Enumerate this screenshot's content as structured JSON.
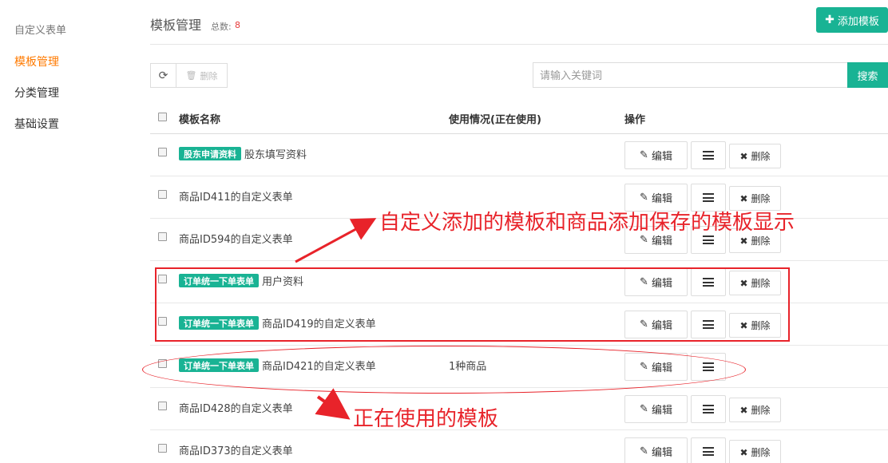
{
  "sidebar": {
    "items": [
      {
        "label": "自定义表单"
      },
      {
        "label": "模板管理"
      },
      {
        "label": "分类管理"
      },
      {
        "label": "基础设置"
      }
    ]
  },
  "header": {
    "title": "模板管理",
    "total_label": "总数:",
    "total_count": "8",
    "add_button": "添加模板"
  },
  "toolbar": {
    "delete_label": "删除",
    "search_placeholder": "请输入关键词",
    "search_button": "搜索"
  },
  "table": {
    "columns": [
      "模板名称",
      "使用情况(正在使用)",
      "操作"
    ],
    "edit_label": "编辑",
    "delete_label": "删除",
    "rows": [
      {
        "tag": "股东申请资料",
        "name": "股东填写资料",
        "usage": ""
      },
      {
        "tag": "",
        "name": "商品ID411的自定义表单",
        "usage": ""
      },
      {
        "tag": "",
        "name": "商品ID594的自定义表单",
        "usage": ""
      },
      {
        "tag": "订单统一下单表单",
        "name": "用户资料",
        "usage": ""
      },
      {
        "tag": "订单统一下单表单",
        "name": "商品ID419的自定义表单",
        "usage": ""
      },
      {
        "tag": "订单统一下单表单",
        "name": "商品ID421的自定义表单",
        "usage": "1种商品"
      },
      {
        "tag": "",
        "name": "商品ID428的自定义表单",
        "usage": ""
      },
      {
        "tag": "",
        "name": "商品ID373的自定义表单",
        "usage": ""
      }
    ]
  },
  "annotations": {
    "top_note": "自定义添加的模板和商品添加保存的模板显示",
    "bottom_note": "正在使用的模板",
    "color": "#e8232a"
  },
  "colors": {
    "accent": "#19b394",
    "active_nav": "#ff7a00",
    "count": "#e63c3c"
  }
}
